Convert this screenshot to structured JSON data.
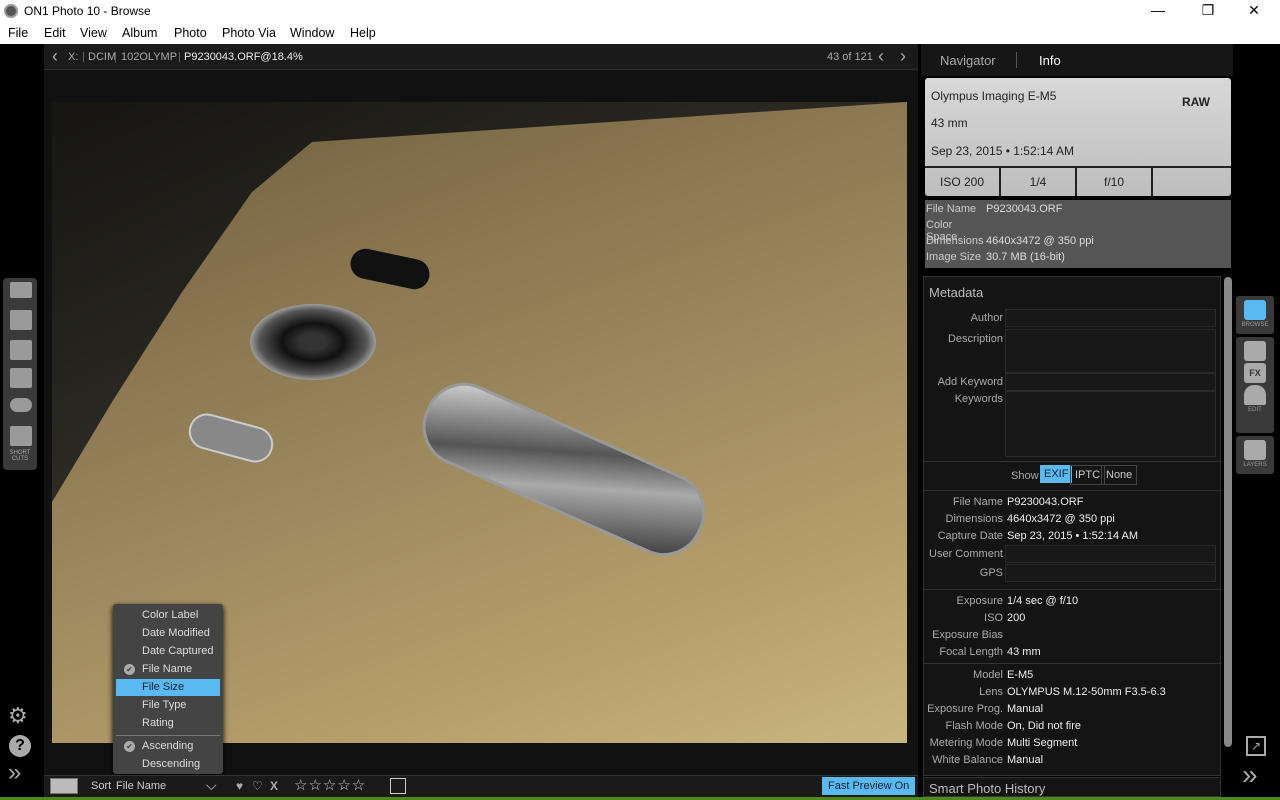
{
  "window": {
    "title": "ON1 Photo 10 - Browse",
    "minimize": "—",
    "maximize": "❐",
    "close": "✕"
  },
  "menu": [
    "File",
    "Edit",
    "View",
    "Album",
    "Photo",
    "Photo Via",
    "Window",
    "Help"
  ],
  "breadcrumb": {
    "back": "‹",
    "items": [
      "X:",
      "DCIM",
      "102OLYMP",
      "P9230043.ORF@18.4%"
    ],
    "counter": "43 of 121",
    "prev": "‹",
    "next": "›"
  },
  "left_panel": {
    "shortcuts_label": "SHORT CUTS"
  },
  "sort_menu": {
    "items": [
      "Color Label",
      "Date Modified",
      "Date Captured",
      "File Name",
      "File Size",
      "File Type",
      "Rating"
    ],
    "checked": "File Name",
    "highlighted": "File Size",
    "order": [
      "Ascending",
      "Descending"
    ],
    "order_checked": "Ascending"
  },
  "bottombar": {
    "sort_label": "Sort",
    "sort_value": "File Name",
    "reject": "X",
    "stars": "☆☆☆☆☆",
    "fast_preview": "Fast Preview On"
  },
  "right_panel": {
    "tabs": [
      "Navigator",
      "Info"
    ],
    "active_tab": "Info",
    "card": {
      "camera": "Olympus Imaging E-M5",
      "format": "RAW",
      "focal": "43 mm",
      "date": "Sep 23, 2015 • 1:52:14 AM",
      "iso": "ISO 200",
      "shutter": "1/4",
      "aperture": "f/10",
      "extra": ""
    },
    "file_info": [
      {
        "k": "File Name",
        "v": "P9230043.ORF"
      },
      {
        "k": "Color Space",
        "v": ""
      },
      {
        "k": "Dimensions",
        "v": "4640x3472 @ 350 ppi"
      },
      {
        "k": "Image Size",
        "v": "30.7 MB (16-bit)"
      }
    ],
    "metadata": {
      "title": "Metadata",
      "author": "Author",
      "description": "Description",
      "add_keyword": "Add Keyword",
      "keywords": "Keywords",
      "show": "Show",
      "show_options": [
        "EXIF",
        "IPTC",
        "None"
      ],
      "show_active": "EXIF"
    },
    "exif1": [
      {
        "k": "File Name",
        "v": "P9230043.ORF"
      },
      {
        "k": "Dimensions",
        "v": "4640x3472 @ 350 ppi"
      },
      {
        "k": "Capture Date",
        "v": "Sep 23, 2015 • 1:52:14 AM"
      },
      {
        "k": "User Comment",
        "v": ""
      },
      {
        "k": "GPS",
        "v": ""
      }
    ],
    "exif2": [
      {
        "k": "Exposure",
        "v": "1/4 sec @ f/10"
      },
      {
        "k": "ISO",
        "v": "200"
      },
      {
        "k": "Exposure Bias",
        "v": ""
      },
      {
        "k": "Focal Length",
        "v": "43 mm"
      }
    ],
    "exif3": [
      {
        "k": "Model",
        "v": "E-M5"
      },
      {
        "k": "Lens",
        "v": " OLYMPUS M.12-50mm F3.5-6.3"
      },
      {
        "k": "Exposure Prog.",
        "v": "Manual"
      },
      {
        "k": "Flash Mode",
        "v": "On, Did not fire"
      },
      {
        "k": "Metering Mode",
        "v": "Multi Segment"
      },
      {
        "k": "White Balance",
        "v": "Manual"
      }
    ],
    "smart_history": "Smart Photo History"
  },
  "right_strip": {
    "browse": "BROWSE",
    "edit": "EDIT",
    "layers": "LAYERS",
    "fx": "FX"
  },
  "colors": {
    "accent": "#5ab9f0",
    "green_bar": "#4e8a1a"
  }
}
